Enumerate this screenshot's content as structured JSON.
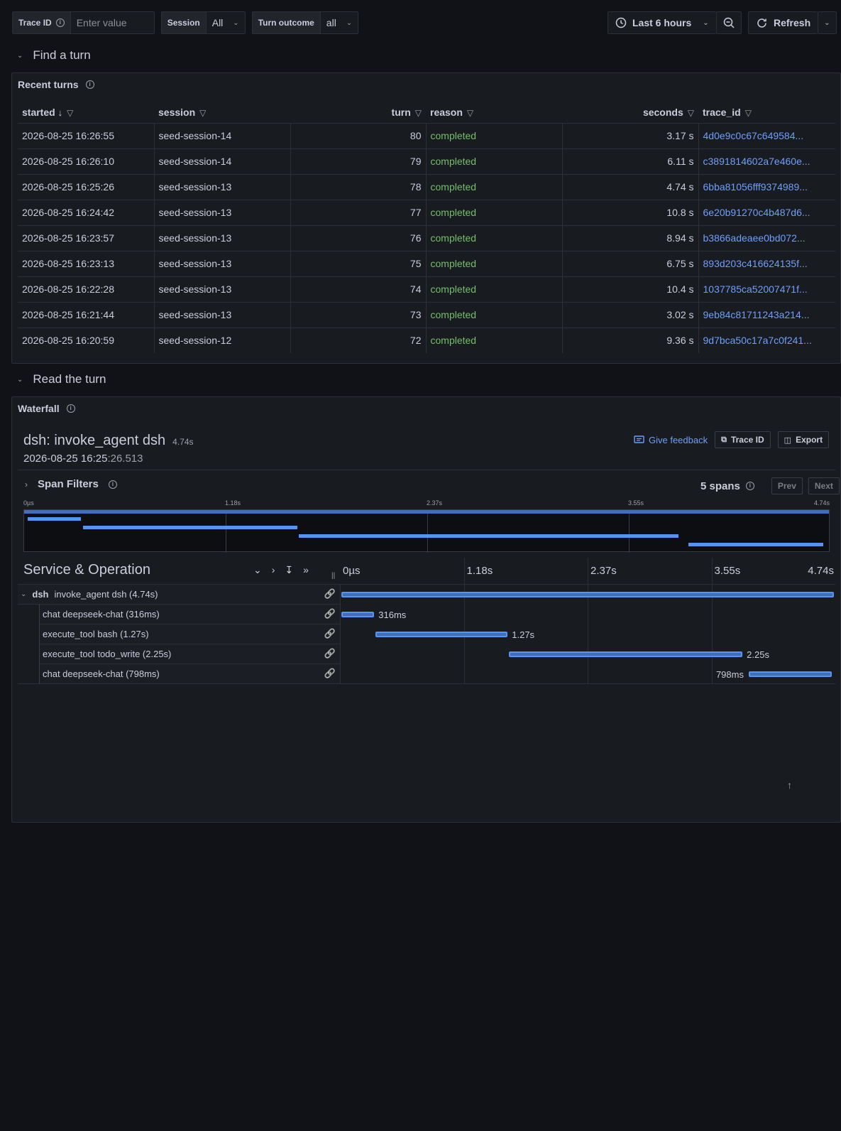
{
  "toolbar": {
    "trace_id_label": "Trace ID",
    "trace_id_placeholder": "Enter value",
    "session_label": "Session",
    "session_value": "All",
    "turn_outcome_label": "Turn outcome",
    "turn_outcome_value": "all",
    "time_range": "Last 6 hours",
    "refresh_label": "Refresh"
  },
  "rows": {
    "find": "Find a turn",
    "read": "Read the turn"
  },
  "recent": {
    "title": "Recent turns",
    "columns": [
      "started",
      "session",
      "turn",
      "reason",
      "seconds",
      "trace_id"
    ],
    "data": [
      [
        "2026-08-25 16:26:55",
        "seed-session-14",
        "80",
        "completed",
        "3.17 s",
        "4d0e9c0c67c649584..."
      ],
      [
        "2026-08-25 16:26:10",
        "seed-session-14",
        "79",
        "completed",
        "6.11 s",
        "c3891814602a7e460e..."
      ],
      [
        "2026-08-25 16:25:26",
        "seed-session-13",
        "78",
        "completed",
        "4.74 s",
        "6bba81056fff9374989..."
      ],
      [
        "2026-08-25 16:24:42",
        "seed-session-13",
        "77",
        "completed",
        "10.8 s",
        "6e20b91270c4b487d6..."
      ],
      [
        "2026-08-25 16:23:57",
        "seed-session-13",
        "76",
        "completed",
        "8.94 s",
        "b3866adeaee0bd072..."
      ],
      [
        "2026-08-25 16:23:13",
        "seed-session-13",
        "75",
        "completed",
        "6.75 s",
        "893d203c416624135f..."
      ],
      [
        "2026-08-25 16:22:28",
        "seed-session-13",
        "74",
        "completed",
        "10.4 s",
        "1037785ca52007471f..."
      ],
      [
        "2026-08-25 16:21:44",
        "seed-session-13",
        "73",
        "completed",
        "3.02 s",
        "9eb84c81711243a214..."
      ],
      [
        "2026-08-25 16:20:59",
        "seed-session-12",
        "72",
        "completed",
        "9.36 s",
        "9d7bca50c17a7c0f241..."
      ]
    ]
  },
  "waterfall": {
    "panel_title": "Waterfall",
    "trace_title": "dsh: invoke_agent dsh",
    "trace_duration": "4.74s",
    "trace_start_main": "2026-08-25 16:25",
    "trace_start_ms": ":26.513",
    "feedback": "Give feedback",
    "trace_id_btn": "Trace ID",
    "export_btn": "Export",
    "span_filters": "Span Filters",
    "span_count": "5 spans",
    "prev": "Prev",
    "next": "Next",
    "ticks": [
      "0µs",
      "1.18s",
      "2.37s",
      "3.55s",
      "4.74s"
    ],
    "header": "Service & Operation",
    "total_s": 4.74,
    "spans": [
      {
        "service": "dsh",
        "name": "invoke_agent dsh (4.74s)",
        "start": 0,
        "dur": 4.74,
        "label": ""
      },
      {
        "service": "",
        "name": "chat deepseek-chat (316ms)",
        "start": 0,
        "dur": 0.316,
        "label": "316ms"
      },
      {
        "service": "",
        "name": "execute_tool bash (1.27s)",
        "start": 0.33,
        "dur": 1.27,
        "label": "1.27s"
      },
      {
        "service": "",
        "name": "execute_tool todo_write (2.25s)",
        "start": 1.61,
        "dur": 2.25,
        "label": "2.25s"
      },
      {
        "service": "",
        "name": "chat deepseek-chat (798ms)",
        "start": 3.92,
        "dur": 0.798,
        "label": "798ms"
      }
    ]
  },
  "colors": {
    "accent": "#5794f2",
    "ok": "#73bf69",
    "link": "#6e9fff"
  }
}
